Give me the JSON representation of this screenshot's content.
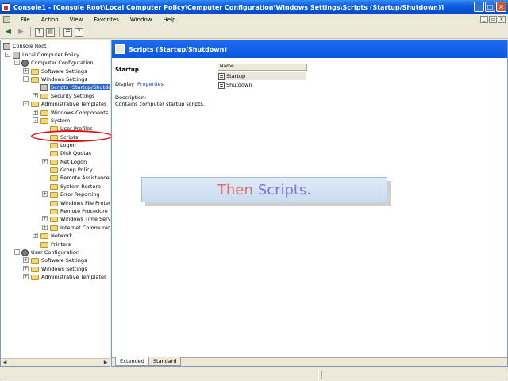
{
  "window": {
    "title": "Console1 - [Console Root\\Local Computer Policy\\Computer Configuration\\Windows Settings\\Scripts (Startup/Shutdown)]",
    "controls": [
      "_",
      "□",
      "×"
    ]
  },
  "menubar": {
    "items": [
      "File",
      "Action",
      "View",
      "Favorites",
      "Window",
      "Help"
    ],
    "mdi_controls": [
      "_",
      "▫",
      "×"
    ]
  },
  "toolbar": {
    "buttons": [
      "back-arrow-icon",
      "forward-arrow-icon",
      "up-folder-icon",
      "show-hide-tree-icon",
      "properties-icon",
      "help-icon"
    ]
  },
  "tree": {
    "items": [
      {
        "label": "Console Root"
      },
      {
        "label": "Local Computer Policy"
      },
      {
        "label": "Computer Configuration"
      },
      {
        "label": "Software Settings"
      },
      {
        "label": "Windows Settings"
      },
      {
        "label": "Scripts (Startup/Shutdown)"
      },
      {
        "label": "Security Settings"
      },
      {
        "label": "Administrative Templates"
      },
      {
        "label": "Windows Components"
      },
      {
        "label": "System"
      },
      {
        "label": "User Profiles"
      },
      {
        "label": "Scripts"
      },
      {
        "label": "Logon"
      },
      {
        "label": "Disk Quotas"
      },
      {
        "label": "Net Logon"
      },
      {
        "label": "Group Policy"
      },
      {
        "label": "Remote Assistance"
      },
      {
        "label": "System Restore"
      },
      {
        "label": "Error Reporting"
      },
      {
        "label": "Windows File Protect"
      },
      {
        "label": "Remote Procedure C"
      },
      {
        "label": "Windows Time Servic"
      },
      {
        "label": "Internet Communicat"
      },
      {
        "label": "Network"
      },
      {
        "label": "Printers"
      },
      {
        "label": "User Configuration"
      },
      {
        "label": "Software Settings"
      },
      {
        "label": "Windows Settings"
      },
      {
        "label": "Administrative Templates"
      }
    ]
  },
  "details": {
    "header_title": "Scripts (Startup/Shutdown)",
    "section_title": "Startup",
    "display_prefix": "Display",
    "display_link": "Properties",
    "description_label": "Description:",
    "description_text": "Contains computer startup scripts.",
    "column_name": "Name",
    "items": [
      "Startup",
      "Shutdown"
    ]
  },
  "caption": {
    "word1": "Then",
    "word2": "Scripts."
  },
  "tabs": [
    "Extended",
    "Standard"
  ]
}
